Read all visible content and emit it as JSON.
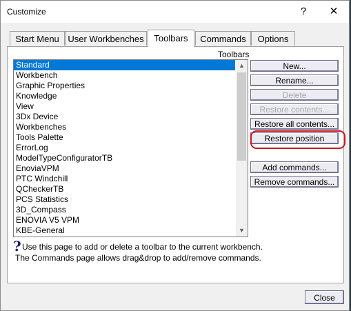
{
  "window": {
    "title": "Customize",
    "help_glyph": "?",
    "close_glyph": "✕"
  },
  "tabs": [
    {
      "label": "Start Menu"
    },
    {
      "label": "User Workbenches"
    },
    {
      "label": "Toolbars"
    },
    {
      "label": "Commands"
    },
    {
      "label": "Options"
    }
  ],
  "active_tab": "Toolbars",
  "toolbars_group_label": "Toolbars",
  "toolbar_list": {
    "items": [
      "Standard",
      "Workbench",
      "Graphic Properties",
      "Knowledge",
      "View",
      "3Dx Device",
      "Workbenches",
      "Tools Palette",
      "ErrorLog",
      "ModelTypeConfiguratorTB",
      "EnoviaVPM",
      "PTC Windchill",
      "QCheckerTB",
      "PCS Statistics",
      "3D_Compass",
      "ENOVIA V5 VPM",
      "KBE-General"
    ],
    "selected": "Standard",
    "scroll_up_glyph": "▲",
    "scroll_down_glyph": "▼"
  },
  "buttons": {
    "new": "New...",
    "rename": "Rename...",
    "delete": "Delete",
    "restore_contents": "Restore contents...",
    "restore_all_contents": "Restore all contents...",
    "restore_position": "Restore position",
    "add_commands": "Add commands...",
    "remove_commands": "Remove commands..."
  },
  "help": {
    "icon": "?",
    "line1": "Use this page to add or delete a toolbar to the current workbench.",
    "line2": "The Commands page allows drag&drop to add/remove commands."
  },
  "close_button": "Close"
}
